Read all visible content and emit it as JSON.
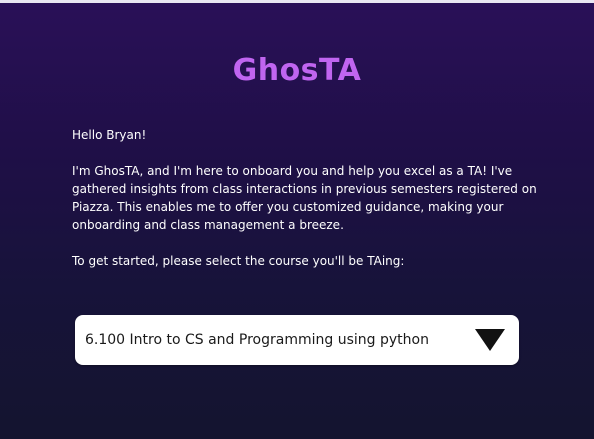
{
  "app": {
    "logo_text": "GhosTA",
    "brand_color": "#c065f0",
    "background_top": "#2a1058",
    "background_bottom": "#14142f"
  },
  "intro": {
    "greeting": "Hello Bryan!",
    "message": "I'm GhosTA, and I'm here to onboard you and help you excel as a TA! I've gathered insights from class interactions in previous semesters registered on Piazza. This enables me to offer you customized guidance, making your onboarding and class management a breeze.",
    "prompt": "To get started, please select the course you'll be TAing:"
  },
  "course_select": {
    "selected_value": "6.100 Intro to CS and Programming using python",
    "icon": "dropdown-arrow-icon"
  }
}
